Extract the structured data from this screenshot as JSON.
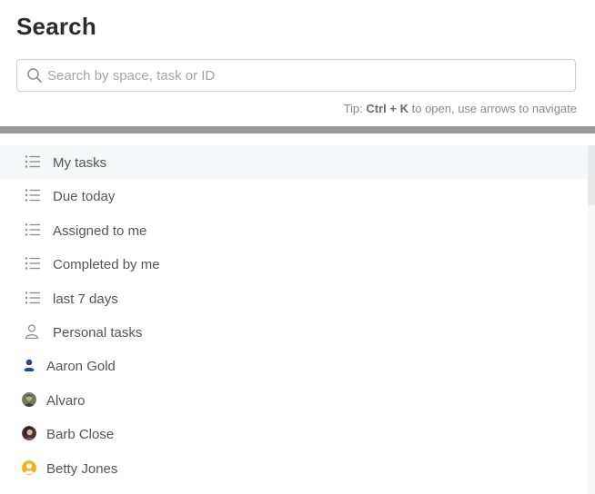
{
  "page": {
    "title": "Search"
  },
  "search": {
    "placeholder": "Search by space, task or ID",
    "value": ""
  },
  "tip": {
    "prefix": "Tip:",
    "shortcut": "Ctrl + K",
    "suffix": "to open, use arrows to navigate"
  },
  "items": [
    {
      "label": "My tasks",
      "icon": "list-icon"
    },
    {
      "label": "Due today",
      "icon": "list-icon"
    },
    {
      "label": "Assigned to me",
      "icon": "list-icon"
    },
    {
      "label": "Completed by me",
      "icon": "list-icon"
    },
    {
      "label": "last 7 days",
      "icon": "list-icon"
    },
    {
      "label": "Personal tasks",
      "icon": "user-outline-icon"
    }
  ],
  "people": [
    {
      "name": "Aaron Gold",
      "avatar": "default-user-avatar",
      "color": "#1a4f8b"
    },
    {
      "name": "Alvaro",
      "avatar": "photo-avatar",
      "color": "#7a6a55"
    },
    {
      "name": "Barb Close",
      "avatar": "photo-avatar",
      "color": "#5a3a3a"
    },
    {
      "name": "Betty Jones",
      "avatar": "default-user-avatar",
      "color": "#f2b01e"
    }
  ],
  "colors": {
    "divider": "#9a9a9a",
    "active_row": "#f6f7f9",
    "text": "#555555"
  }
}
